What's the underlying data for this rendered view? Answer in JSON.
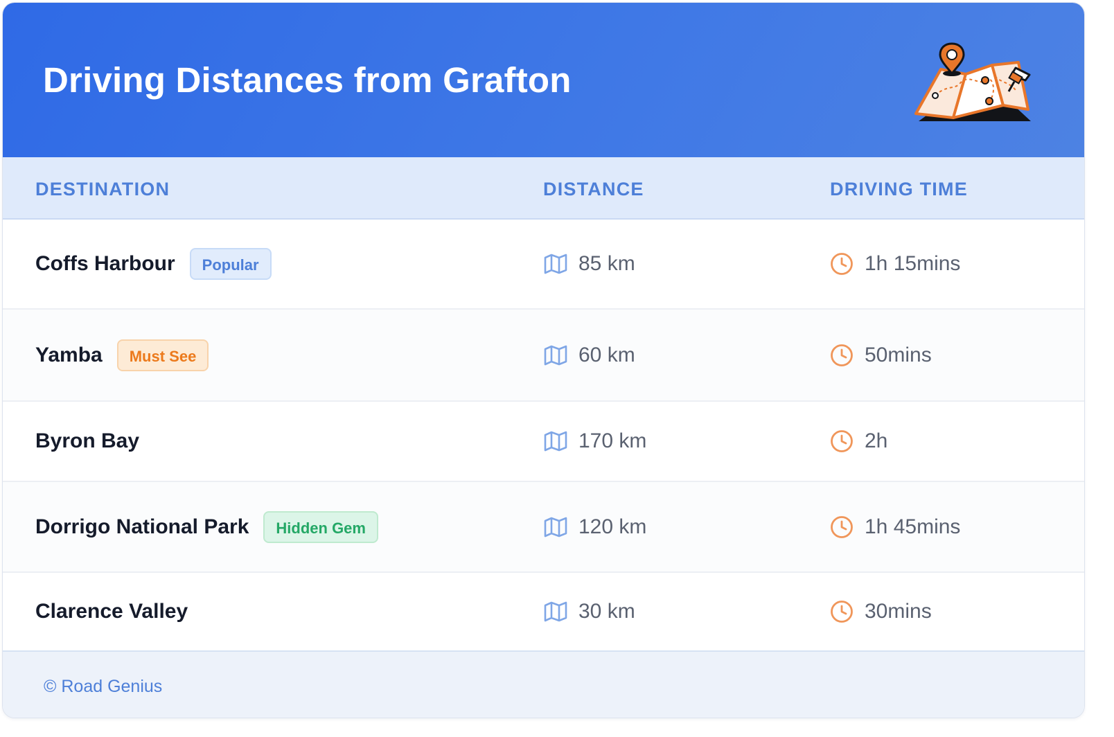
{
  "header": {
    "title": "Driving Distances from Grafton",
    "illustration_icon": "folded-map-with-pins-icon"
  },
  "table": {
    "columns": [
      "DESTINATION",
      "DISTANCE",
      "DRIVING TIME"
    ],
    "distance_icon": "map-icon",
    "time_icon": "clock-icon",
    "rows": [
      {
        "destination": "Coffs Harbour",
        "badge": "Popular",
        "badge_color": "#4d7fd8",
        "distance": "85 km",
        "time": "1h 15mins"
      },
      {
        "destination": "Yamba",
        "badge": "Must See",
        "badge_color": "#ec7a1c",
        "distance": "60 km",
        "time": "50mins"
      },
      {
        "destination": "Byron Bay",
        "badge": "",
        "distance": "170 km",
        "time": "2h"
      },
      {
        "destination": "Dorrigo National Park",
        "badge": "Hidden Gem",
        "badge_color": "#24a866",
        "distance": "120 km",
        "time": "1h 45mins"
      },
      {
        "destination": "Clarence Valley",
        "badge": "",
        "distance": "30 km",
        "time": "30mins"
      }
    ]
  },
  "footer": {
    "text": "© Road Genius"
  },
  "colors": {
    "header_blue": "#2f6ae6",
    "accent_blue": "#4d7fd8",
    "accent_orange": "#ec7a1c",
    "accent_green": "#24a866"
  }
}
